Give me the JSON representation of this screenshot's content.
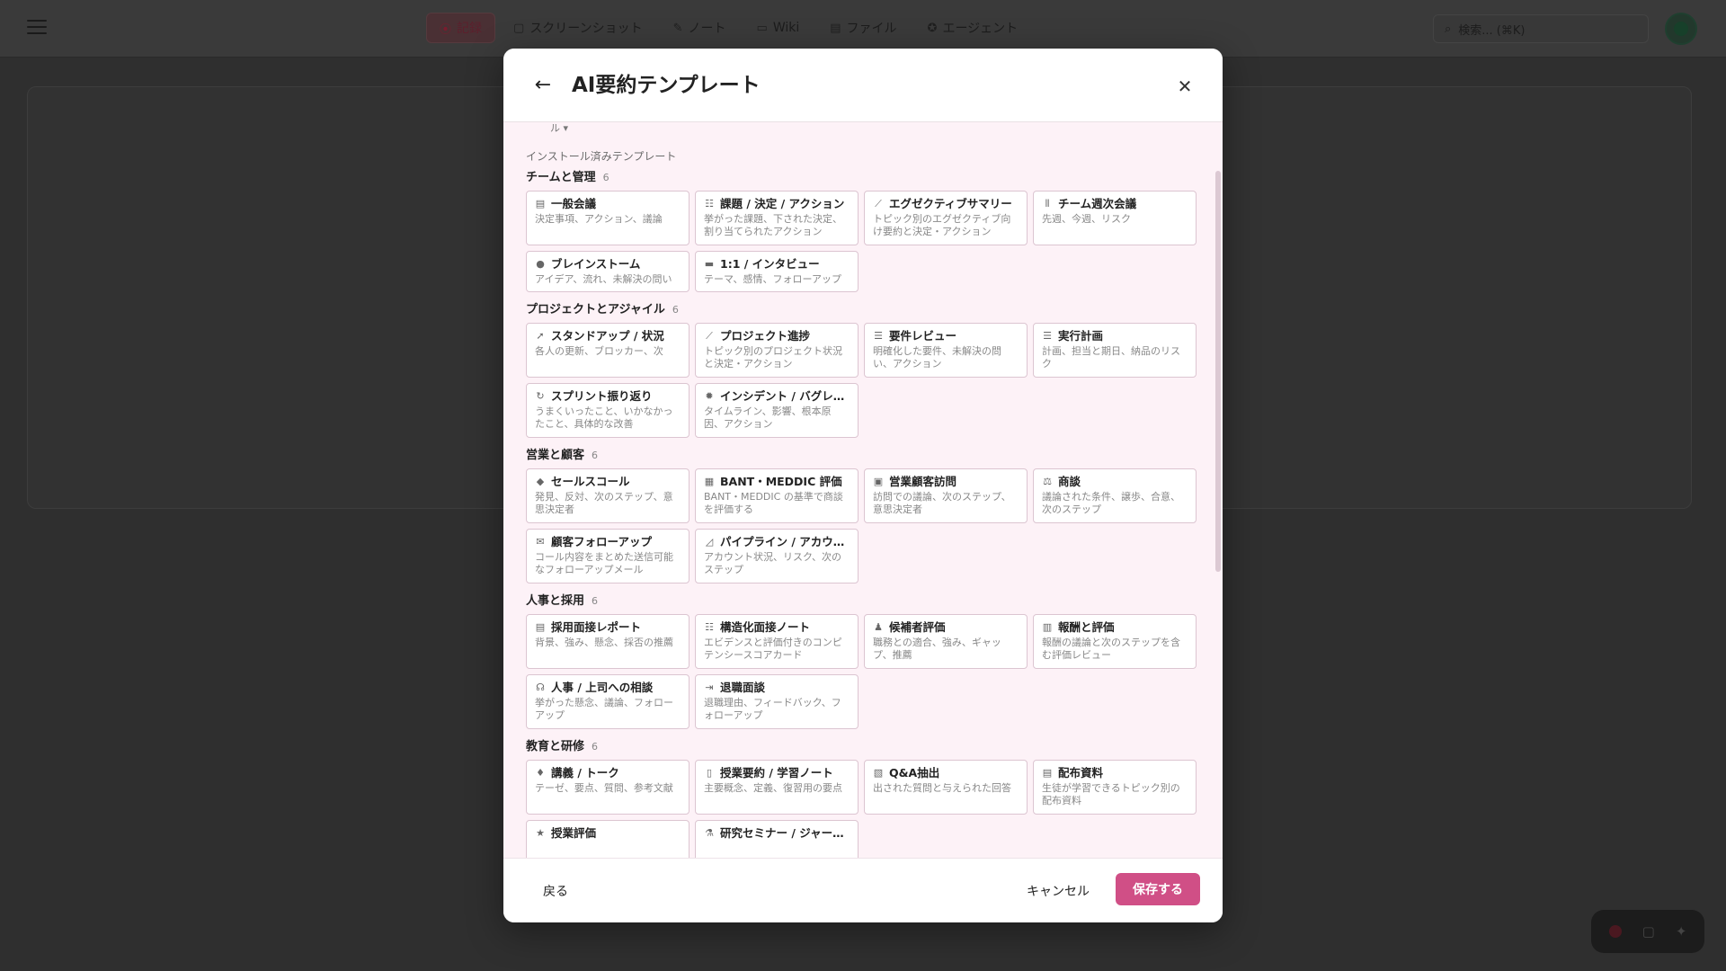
{
  "nav": {
    "items": [
      {
        "icon": "record-icon",
        "glyph": "⦿",
        "label": "記録",
        "active": true
      },
      {
        "icon": "screenshot-icon",
        "glyph": "▢",
        "label": "スクリーンショット"
      },
      {
        "icon": "note-icon",
        "glyph": "✎",
        "label": "ノート"
      },
      {
        "icon": "wiki-icon",
        "glyph": "▭",
        "label": "Wiki"
      },
      {
        "icon": "file-icon",
        "glyph": "▤",
        "label": "ファイル"
      },
      {
        "icon": "agent-icon",
        "glyph": "✪",
        "label": "エージェント"
      }
    ],
    "search_placeholder": "検索... (⌘K)"
  },
  "modal": {
    "title": "AI要約テンプレート",
    "peek_text": "ル ▾",
    "installed_label": "インストール済みテンプレート",
    "sections": [
      {
        "title": "チームと管理",
        "count": "6",
        "templates": [
          {
            "icon": "document-icon",
            "glyph": "▤",
            "name": "一般会議",
            "desc": "決定事項、アクション、議論"
          },
          {
            "icon": "checklist-icon",
            "glyph": "☷",
            "name": "課題 / 決定 / アクション",
            "desc": "挙がった課題、下された決定、割り当てられたアクション"
          },
          {
            "icon": "trend-icon",
            "glyph": "⟋",
            "name": "エグゼクティブサマリー",
            "desc": "トピック別のエグゼクティブ向け要約と決定・アクション"
          },
          {
            "icon": "columns-icon",
            "glyph": "⦀",
            "name": "チーム週次会議",
            "desc": "先週、今週、リスク"
          },
          {
            "icon": "bulb-icon",
            "glyph": "●",
            "name": "ブレインストーム",
            "desc": "アイデア、流れ、未解決の問い"
          },
          {
            "icon": "chat-icon",
            "glyph": "▬",
            "name": "1:1 / インタビュー",
            "desc": "テーマ、感情、フォローアップ"
          }
        ]
      },
      {
        "title": "プロジェクトとアジャイル",
        "count": "6",
        "templates": [
          {
            "icon": "rocket-icon",
            "glyph": "➚",
            "name": "スタンドアップ / 状況",
            "desc": "各人の更新、ブロッカー、次"
          },
          {
            "icon": "trend-icon",
            "glyph": "⟋",
            "name": "プロジェクト進捗",
            "desc": "トピック別のプロジェクト状況と決定・アクション"
          },
          {
            "icon": "list-check-icon",
            "glyph": "☰",
            "name": "要件レビュー",
            "desc": "明確化した要件、未解決の問い、アクション"
          },
          {
            "icon": "list-check-icon",
            "glyph": "☰",
            "name": "実行計画",
            "desc": "計画、担当と期日、納品のリスク"
          },
          {
            "icon": "refresh-icon",
            "glyph": "↻",
            "name": "スプリント振り返り",
            "desc": "うまくいったこと、いかなかったこと、具体的な改善"
          },
          {
            "icon": "bug-icon",
            "glyph": "✹",
            "name": "インシデント / バグレビュー",
            "desc": "タイムライン、影響、根本原因、アクション"
          }
        ]
      },
      {
        "title": "営業と顧客",
        "count": "6",
        "templates": [
          {
            "icon": "gem-icon",
            "glyph": "◆",
            "name": "セールスコール",
            "desc": "発見、反対、次のステップ、意思決定者"
          },
          {
            "icon": "scorecard-icon",
            "glyph": "▦",
            "name": "BANT・MEDDIC 評価",
            "desc": "BANT・MEDDIC の基準で商談を評価する"
          },
          {
            "icon": "car-icon",
            "glyph": "▣",
            "name": "営業顧客訪問",
            "desc": "訪問での議論、次のステップ、意思決定者"
          },
          {
            "icon": "scale-icon",
            "glyph": "⚖",
            "name": "商談",
            "desc": "議論された条件、譲歩、合意、次のステップ"
          },
          {
            "icon": "mail-icon",
            "glyph": "✉",
            "name": "顧客フォローアップ",
            "desc": "コール内容をまとめた送信可能なフォローアップメール"
          },
          {
            "icon": "chart-icon",
            "glyph": "◿",
            "name": "パイプライン / アカウントレビュー",
            "desc": "アカウント状況、リスク、次のステップ"
          }
        ]
      },
      {
        "title": "人事と採用",
        "count": "6",
        "templates": [
          {
            "icon": "document-icon",
            "glyph": "▤",
            "name": "採用面接レポート",
            "desc": "背景、強み、懸念、採否の推薦"
          },
          {
            "icon": "checklist-icon",
            "glyph": "☷",
            "name": "構造化面接ノート",
            "desc": "エビデンスと評価付きのコンピテンシースコアカード"
          },
          {
            "icon": "user-check-icon",
            "glyph": "♟",
            "name": "候補者評価",
            "desc": "職務との適合、強み、ギャップ、推薦"
          },
          {
            "icon": "money-icon",
            "glyph": "▥",
            "name": "報酬と評価",
            "desc": "報酬の議論と次のステップを含む評価レビュー"
          },
          {
            "icon": "headset-icon",
            "glyph": "☊",
            "name": "人事 / 上司への相談",
            "desc": "挙がった懸念、議論、フォローアップ"
          },
          {
            "icon": "exit-icon",
            "glyph": "⇥",
            "name": "退職面談",
            "desc": "退職理由、フィードバック、フォローアップ"
          }
        ]
      },
      {
        "title": "教育と研修",
        "count": "6",
        "templates": [
          {
            "icon": "graduation-cap-icon",
            "glyph": "♦",
            "name": "講義 / トーク",
            "desc": "テーゼ、要点、質問、参考文献"
          },
          {
            "icon": "book-icon",
            "glyph": "▯",
            "name": "授業要約 / 学習ノート",
            "desc": "主要概念、定義、復習用の要点"
          },
          {
            "icon": "qa-icon",
            "glyph": "▧",
            "name": "Q&A抽出",
            "desc": "出された質問と与えられた回答"
          },
          {
            "icon": "handout-icon",
            "glyph": "▤",
            "name": "配布資料",
            "desc": "生徒が学習できるトピック別の配布資料"
          },
          {
            "icon": "star-icon",
            "glyph": "★",
            "name": "授業評価",
            "desc": ""
          },
          {
            "icon": "flask-icon",
            "glyph": "⚗",
            "name": "研究セミナー / ジャーナルクラブ",
            "desc": ""
          }
        ]
      }
    ]
  },
  "footer": {
    "back_label": "戻る",
    "cancel_label": "キャンセル",
    "save_label": "保存する"
  },
  "colors": {
    "accent": "#d04f86",
    "body_tint": "#fdf2f7",
    "card_border": "#dcc5d1"
  }
}
